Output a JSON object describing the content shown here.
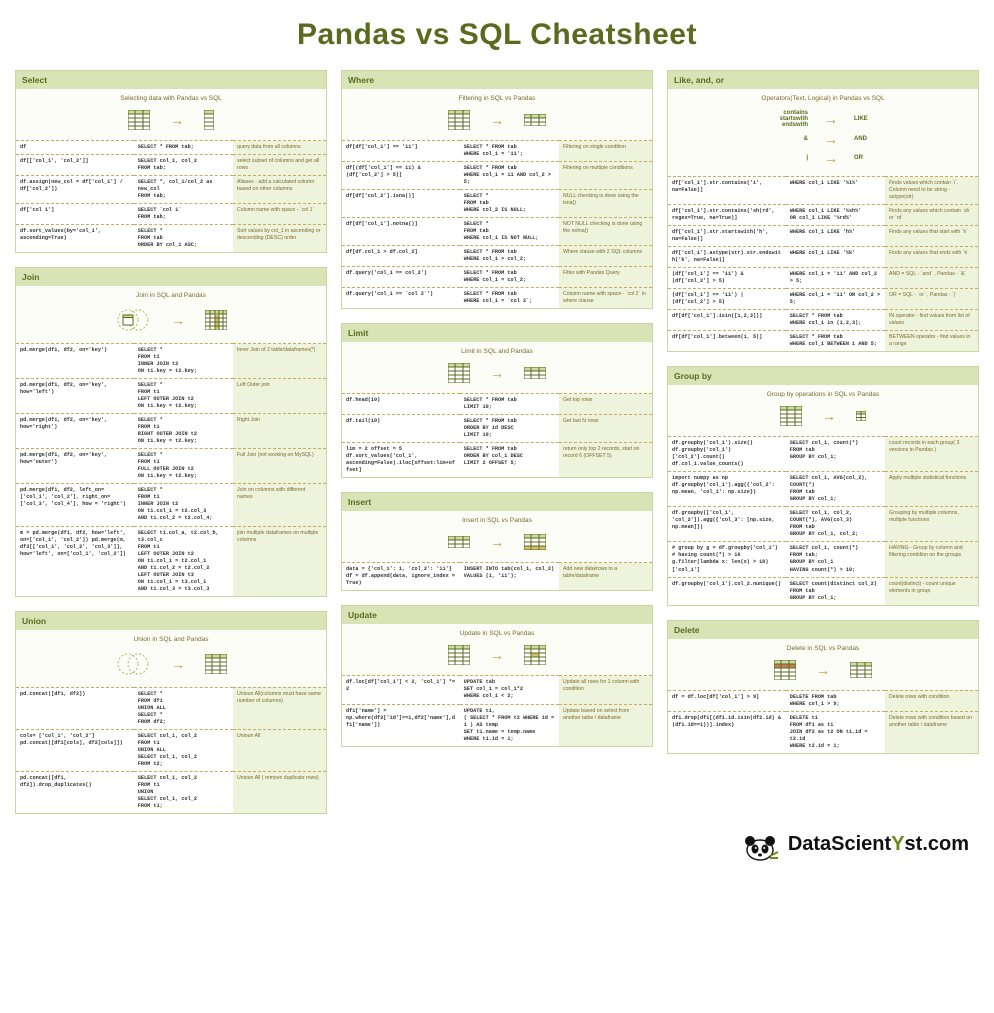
{
  "title": "Pandas vs SQL Cheatsheet",
  "footer": "DataScientYst.com",
  "sections": {
    "select": {
      "header": "Select",
      "sub": "Selecting data with Pandas vs SQL",
      "rows": [
        {
          "p": "df",
          "s": "SELECT * FROM tab;",
          "d": "query data from all columns"
        },
        {
          "p": "df[['col_1', 'col_2']]",
          "s": "SELECT col_1, col_2\nFROM tab;",
          "d": "select subset of columns and get all rows"
        },
        {
          "p": "df.assign(new_col = df['col_1'] / df['col_2'])",
          "s": "SELECT *, col_1/col_2 as new_col\nFROM tab;",
          "d": "Aliases - add a calculated column based on other columns"
        },
        {
          "p": "df['col 1']",
          "s": "SELECT `col 1`\nFROM tab;",
          "d": "Column name with space - `col 1`"
        },
        {
          "p": "df.sort_values(by='col_1', ascending=True)",
          "s": "SELECT *\nFROM tab\nORDER BY col_1 ASC;",
          "d": "Sort values by col_1 in ascending or descending (DESC) order"
        }
      ]
    },
    "join": {
      "header": "Join",
      "sub": "Join in SQL and Pandas",
      "rows": [
        {
          "p": "pd.merge(df1, df2, on='key')",
          "s": "SELECT *\nFROM t1\nINNER JOIN t2\nON t1.key = t2.key;",
          "d": "Inner Join of 2 table/dataframes(*)"
        },
        {
          "p": "pd.merge(df1, df2, on='key', how='left')",
          "s": "SELECT *\nFROM t1\nLEFT OUTER JOIN t2\nON t1.key = t2.key;",
          "d": "Left Outer join"
        },
        {
          "p": "pd.merge(df1, df2, on='key', how='right')",
          "s": "SELECT *\nFROM t1\nRIGHT OUTER JOIN t2\nON t1.key = t2.key;",
          "d": "Right Join"
        },
        {
          "p": "pd.merge(df1, df2, on='key', how='outer')",
          "s": "SELECT *\nFROM t1\nFULL OUTER JOIN t2\nON t1.key = t2.key;",
          "d": "Full Join (not working on MySQL)"
        },
        {
          "p": "pd.merge(df1, df2, left_on=['col_1', 'col_2'], right_on=['col_3', 'col_4'], how = 'right')",
          "s": "SELECT *\nFROM t1\nINNER JOIN t2\nON t1.col_1 = t2.col_3\nAND t1.col_2 = t2.col_4;",
          "d": "Join on columns with different names"
        },
        {
          "p": "m = pd.merge(df1, df2, how='left', on=['col_1', 'col_2'])\npd.merge(m, df3[['col_1', 'col_2', 'col_3']], how='left', on=['col_1', 'col_2'])",
          "s": "SELECT t1.col_a, t2.col_b, t3.col_c\nFROM t1\nLEFT OUTER JOIN t2\nON t1.col_1 = t2.col_1\nAND t1.col_2 = t2.col_2\nLEFT OUTER JOIN t3\nON t1.col_1 = t3.col_1\nAND t1.col_3 = t3.col_3",
          "d": "join multiple dataframes on multiple columns"
        }
      ]
    },
    "union": {
      "header": "Union",
      "sub": "Union in SQL and Pandas",
      "rows": [
        {
          "p": "pd.concat([df1, df2])",
          "s": "SELECT *\nFROM df1\nUNION ALL\nSELECT *\nFROM df2;",
          "d": "Unioun All(columns must have same number of columns)"
        },
        {
          "p": "cols= ['col_1', 'col_2'] pd.concat([df1[cols], df2[cols]])",
          "s": "SELECT col_1, col_2\nFROM t1\nUNION ALL\nSELECT col_1, col_2\nFROM t2;",
          "d": "Unioun All"
        },
        {
          "p": "pd.concat([df1, df2]).drop_duplicates()",
          "s": "SELECT col_1, col_2\nFROM t1\nUNION\nSELECT col_1, col_2\nFROM t1;",
          "d": "Unioun All ( remove duplicate rows)"
        }
      ]
    },
    "where": {
      "header": "Where",
      "sub": "Filtering in SQL vs Pandas",
      "rows": [
        {
          "p": "df[df['col_1'] == '11']",
          "s": "SELECT * FROM tab\nWHERE col_1 = '11';",
          "d": "Filtering on single condition"
        },
        {
          "p": "df[(df['col_1'] == 11) & (df['col_2'] > 5)]",
          "s": "SELECT * FROM tab\nWHERE col_1 = 11 AND col_2 > 5;",
          "d": "Filtering on multiple conditions"
        },
        {
          "p": "df[df['col_2'].isna()]",
          "s": "SELECT *\nFROM tab\nWHERE col_2 IS NULL;",
          "d": "NULL checking is done using the isna()"
        },
        {
          "p": "df[df['col_1'].notna()]",
          "s": "SELECT *\nFROM tab\nWHERE col_1 IS NOT NULL;",
          "d": "NOT NULL checking is done using the notna()"
        },
        {
          "p": "df[df.col_1 > df.col_2]",
          "s": "SELECT * FROM tab\nWHERE col_1 > col_2;",
          "d": "Where clause with 2 SQL columns"
        },
        {
          "p": "df.query('col_1 == col_2')",
          "s": "SELECT * FROM tab\nWHERE col_1 = col_2;",
          "d": "Filter with Pandas Query"
        },
        {
          "p": "df.query('col_1 == `col 2`')",
          "s": "SELECT * FROM tab\nWHERE col_1 = `col 2`;",
          "d": "Column name with space - `col 2` in where clause"
        }
      ]
    },
    "limit": {
      "header": "Limit",
      "sub": "Limit in SQL and Pandas",
      "rows": [
        {
          "p": "df.head(10)",
          "s": "SELECT * FROM tab\nLIMIT 10;",
          "d": "Get top rows"
        },
        {
          "p": "df.tail(10)",
          "s": "SELECT * FROM tab\nORDER BY id DESC\nLIMIT 10;",
          "d": "Get last N rows"
        },
        {
          "p": "lim = 2\noffset = 5\ndf.sort_values('col_1', ascending=False).iloc[offset:lim+offset]",
          "s": "SELECT * FROM tab\nORDER BY col_1 DESC\nLIMIT 2 OFFSET 5;",
          "d": "return only top 2 records, start on record 6 (OFFSET 5)"
        }
      ]
    },
    "insert": {
      "header": "Insert",
      "sub": "Insert in SQL vs Pandas",
      "rows": [
        {
          "p": "data = {'col_1': 1, 'col_2': '11'}\ndf = df.append(data, ignore_index = True)",
          "s": "INSERT INTO tab(col_1, col_2)\nVALUES (1, '11');",
          "d": "Add new data/rows to a table/dataframe"
        }
      ]
    },
    "update": {
      "header": "Update",
      "sub": "Update in SQL vs Pandas",
      "rows": [
        {
          "p": "df.loc[df['col_1'] < 2, 'col_1'] *= 2",
          "s": "UPDATE tab\nSET col_1 = col_1*2\nWHERE col_1 < 2;",
          "d": "Update all rows for 1 column with condition"
        },
        {
          "p": "df1['name'] = np.where(df2['id']==1,df2['name'],df1['name'])",
          "s": "UPDATE t1,\n( SELECT * FROM t2 WHERE id = 1 ) AS temp\nSET t1.name = temp.name\nWHERE t1.id = 1;",
          "d": "Update based on select from another table / dataframe"
        }
      ]
    },
    "like": {
      "header": "Like, and, or",
      "sub": "Operators(Text, Logical) in Pandas vs SQL",
      "map": {
        "l": [
          "contains",
          "startswith",
          "endswith",
          "&",
          "|"
        ],
        "r": [
          "LIKE",
          "",
          "",
          "AND",
          "OR"
        ]
      },
      "rows": [
        {
          "p": "df['col_1'].str.contains('i', na=False)]",
          "s": "WHERE col_1 LIKE '%i%'",
          "d": "Finds values which contain `i`. Column need to be string - astype(str)"
        },
        {
          "p": "df['col_1'].str.contains('sh|rd', regex=True, na=True)]",
          "s": "WHERE col_1 LIKE '%sh%'\nOR col_1 LIKE '%rd%'",
          "d": "Finds any values which contain `sh` or `rd`"
        },
        {
          "p": "df['col_1'].str.startswith('h', na=False)]",
          "s": "WHERE col_1 LIKE 'h%'",
          "d": "Finds any values that start with `h`"
        },
        {
          "p": "df['col_1'].astype(str).str.endswith('k', na=False)]",
          "s": "WHERE col_1 LIKE '%k'",
          "d": "Finds any values that ends with `k`"
        },
        {
          "p": "(df['col_1'] == '11') & (df['col_2'] > 5)",
          "s": "WHERE col_1 = '11' AND col_2 > 5;",
          "d": "AND = SQL - `and` , Pandas - `&`"
        },
        {
          "p": "(df['col_1'] == '11') | (df['col_2'] > 5)",
          "s": "WHERE col_1 = '11' OR col_2 > 5;",
          "d": "OR = SQL - `or` , Pandas - `|`"
        },
        {
          "p": "df[df['col_1'].isin([1,2,3])]",
          "s": "SELECT * FROM tab\nWHERE col_1 in (1,2,3);",
          "d": "IN operator - find values from list of values"
        },
        {
          "p": "df[df['col_1'].between(1, 5)]",
          "s": "SELECT * FROM tab\nWHERE col_1 BETWEEN 1 AND 5;",
          "d": "BETWEEN operator - find values in a range"
        }
      ]
    },
    "groupby": {
      "header": "Group by",
      "sub": "Group by operations in SQL vs Pandas",
      "rows": [
        {
          "p": "df.groupby('col_1').size()\ndf.groupby('col_1')['col_2'].count()\ndf.col_1.value_counts()",
          "s": "SELECT col_1, count(*)\nFROM tab\nGROUP BY col_1;",
          "d": "count records in each group( 3 versions in Pandas )"
        },
        {
          "p": "import numpy as np\ndf.groupby('col_1').agg({'col_2': np.mean, 'col_1': np.size})",
          "s": "SELECT col_1, AVG(col_2), COUNT(*)\nFROM tab\nGROUP BY col_1;",
          "d": "Apply multiple statistical functions"
        },
        {
          "p": "df.groupby(['col_1', 'col_2']).agg({'col_3': [np.size, np.mean]})",
          "s": "SELECT col_1, col_2, COUNT(*), AVG(col_3)\nFROM tab\nGROUP BY col_1, col_2;",
          "d": "Grouping by multiple columns, multiple functions"
        },
        {
          "p": "# group by\ng = df.groupby('col_1')\n# having count(*) > 10\ng.filter(lambda x: len(x) > 10)['col_1']",
          "s": "SELECT col_1, count(*)\nFROM tab;\nGROUP BY col_1\nHAVING count(*) > 10;",
          "d": "HAVING - Group by column and filtering contidion on the groups"
        },
        {
          "p": "df.groupby('col_1').col_2.nunique()",
          "s": "SELECT count(distinct col_2)\nFROM tab\nGROUP BY col_1;",
          "d": "count(distinct) - count unique elements in group"
        }
      ]
    },
    "delete": {
      "header": "Delete",
      "sub": "Delete in SQL vs Pandas",
      "rows": [
        {
          "p": "df = df.loc[df['col_1'] > 9]",
          "s": "DELETE FROM tab\nWHERE col_1 > 9;",
          "d": "Delete rows with condition"
        },
        {
          "p": "df1.drop(df1[(df1.id.isin(df2.id) & (df1.id==1))].index)",
          "s": "DELETE t1\nFROM df1 as t1\nJOIN df2 as t2 ON t1.id = t2.id\nWHERE t2.id = 1;",
          "d": "Delete rows with condition based on another table / dataframe"
        }
      ]
    }
  }
}
